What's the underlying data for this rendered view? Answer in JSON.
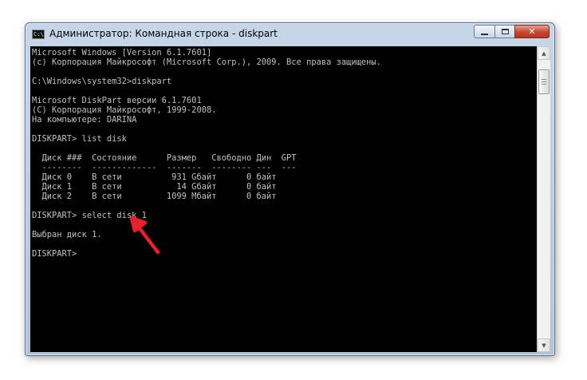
{
  "window": {
    "title": "Администратор: Командная строка - diskpart",
    "icon_label": "C:\\",
    "controls": {
      "minimize": "minimize-icon",
      "maximize": "maximize-icon",
      "close": "close-icon",
      "close_glyph": "✕"
    }
  },
  "console": {
    "background": "#000000",
    "text_color": "#c0c0c0",
    "lines": [
      "Microsoft Windows [Version 6.1.7601]",
      "(c) Корпорация Майкрософт (Microsoft Corp.), 2009. Все права защищены.",
      "",
      "C:\\Windows\\system32>diskpart",
      "",
      "Microsoft DiskPart версии 6.1.7601",
      "(C) Корпорация Майкрософт, 1999-2008.",
      "На компьютере: DARINA",
      "",
      "DISKPART> list disk",
      "",
      "  Диск ###  Состояние      Размер   Свободно Дин  GPT",
      "  --------  -------------  -------  -------- ---  ---",
      "  Диск 0    В сети          931 Gбайт      0 байт",
      "  Диск 1    В сети           14 Gбайт      0 байт",
      "  Диск 2    В сети         1099 Мбайт      0 байт",
      "",
      "DISKPART> select disk 1",
      "",
      "Выбран диск 1.",
      "",
      "DISKPART>"
    ]
  },
  "scrollbar": {
    "up_glyph": "▲",
    "down_glyph": "▼"
  },
  "annotation": {
    "arrow_color": "#e8202a"
  }
}
